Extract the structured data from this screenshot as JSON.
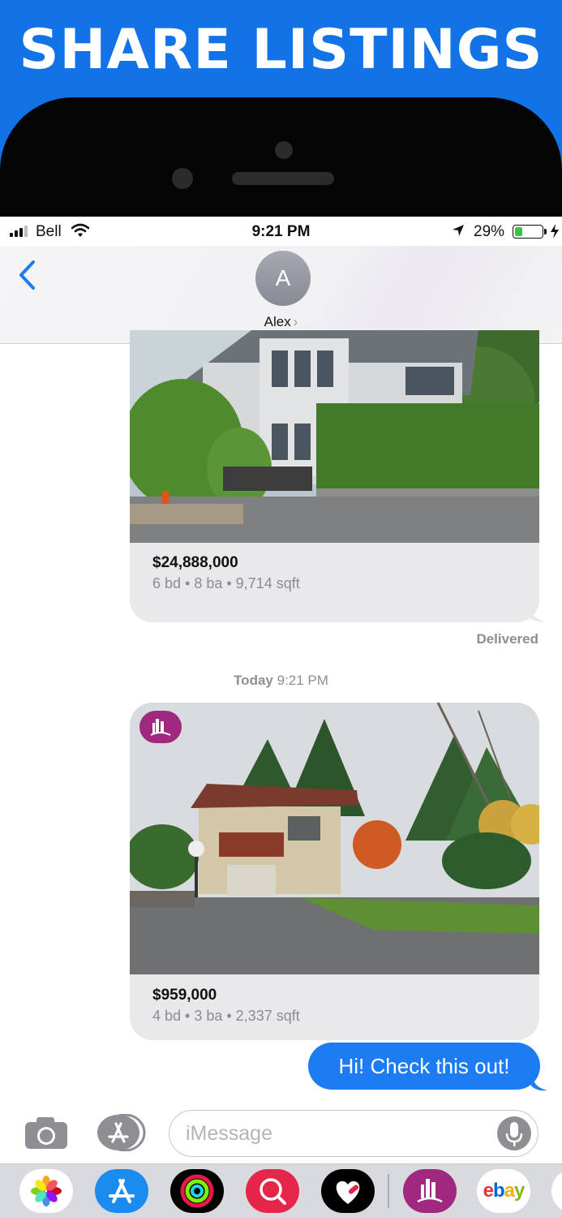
{
  "banner": {
    "title": "SHARE LISTINGS"
  },
  "status_bar": {
    "carrier": "Bell",
    "time": "9:21 PM",
    "battery_percent": "29%",
    "battery_level": 0.29
  },
  "conversation": {
    "contact_initial": "A",
    "contact_name": "Alex",
    "contact_chevron": "›"
  },
  "messages": {
    "listing_1": {
      "price": "$24,888,000",
      "details": "6 bd • 8 ba • 9,714 sqft"
    },
    "delivered": "Delivered",
    "timestamp_day": "Today",
    "timestamp_time": "9:21 PM",
    "listing_2": {
      "price": "$959,000",
      "details": "4 bd • 3 ba • 2,337 sqft"
    },
    "outgoing_text": "Hi! Check this out!"
  },
  "input_bar": {
    "placeholder": "iMessage"
  },
  "app_drawer": {
    "apps": [
      "photos-icon",
      "app-store-icon",
      "activity-icon",
      "search-app-icon",
      "heart-app-icon",
      "listings-app-icon",
      "ebay-icon"
    ],
    "ebay_label": "ebay"
  },
  "colors": {
    "banner": "#1273e6",
    "bubble_blue": "#1e7cf2",
    "bubble_grey": "#e9e9eb",
    "app_brand": "#a1287f"
  }
}
